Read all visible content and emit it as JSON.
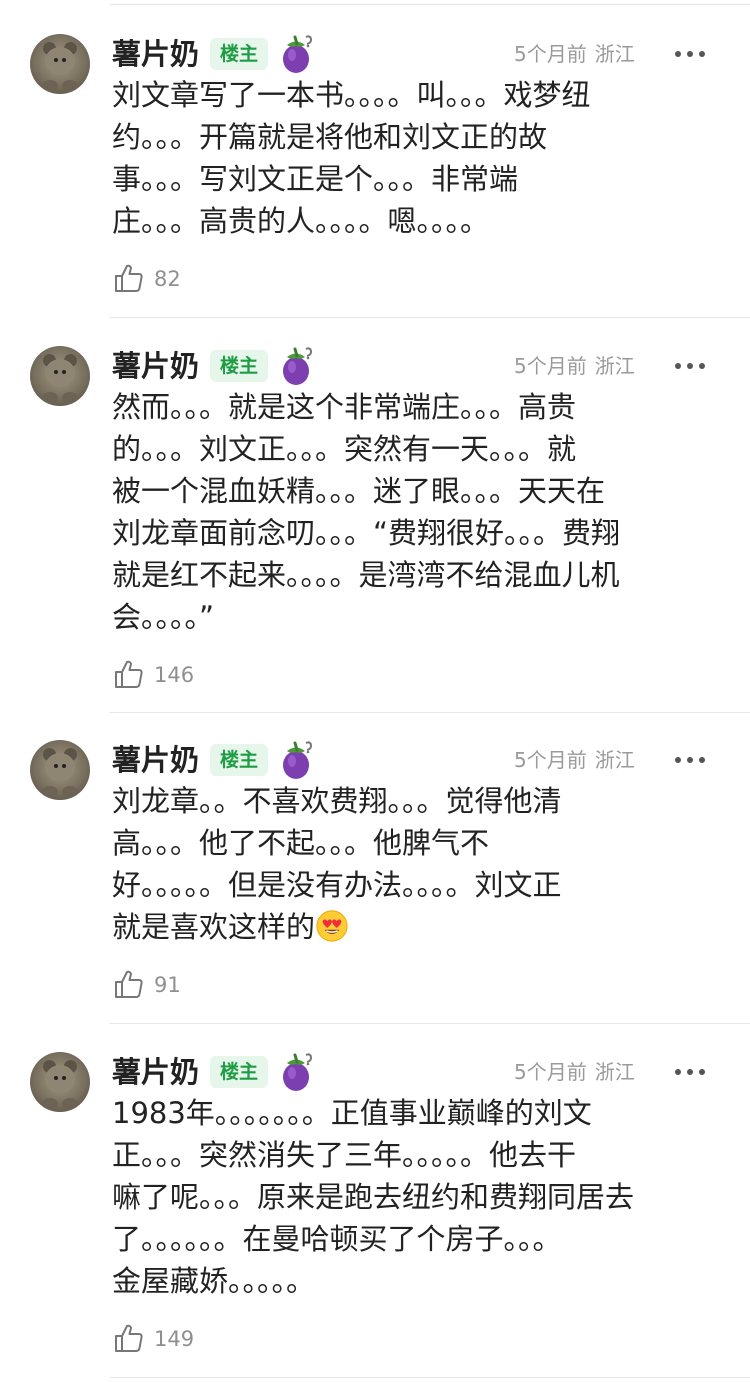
{
  "comments": [
    {
      "author": "薯片奶",
      "badge": "楼主",
      "time": "5个月前",
      "location": "浙江",
      "lines": [
        "刘文章写了一本书。。。。叫。。。戏梦纽",
        "约。。。开篇就是将他和刘文正的故",
        "事。。。写刘文正是个。。。非常端",
        "庄。。。高贵的人。。。。嗯。。。。"
      ],
      "likes": "82",
      "avatar_icon": "teddy-bear-avatar",
      "badge_icon": "eggplant-icon"
    },
    {
      "author": "薯片奶",
      "badge": "楼主",
      "time": "5个月前",
      "location": "浙江",
      "lines": [
        "然而。。。就是这个非常端庄。。。高贵",
        "的。。。刘文正。。。突然有一天。。。就",
        "被一个混血妖精。。。迷了眼。。。天天在",
        "刘龙章面前念叨。。。“费翔很好。。。费翔",
        "就是红不起来。。。。是湾湾不给混血儿机",
        "会。。。。”"
      ],
      "likes": "146",
      "avatar_icon": "teddy-bear-avatar",
      "badge_icon": "eggplant-icon"
    },
    {
      "author": "薯片奶",
      "badge": "楼主",
      "time": "5个月前",
      "location": "浙江",
      "lines": [
        "刘龙章。。不喜欢费翔。。。觉得他清",
        "高。。。他了不起。。。他脾气不",
        "好。。。。。但是没有办法。。。。刘文正",
        "就是喜欢这样的"
      ],
      "likes": "91",
      "avatar_icon": "teddy-bear-avatar",
      "badge_icon": "eggplant-icon",
      "trailing_emoji": "heart-eyes-emoji"
    },
    {
      "author": "薯片奶",
      "badge": "楼主",
      "time": "5个月前",
      "location": "浙江",
      "lines": [
        "1983年。。。。。。。正值事业巅峰的刘文",
        "正。。。突然消失了三年。。。。。他去干",
        "嘛了呢。。。原来是跑去纽约和费翔同居去",
        "了。。。。。。在曼哈顿买了个房子。。。",
        "金屋藏娇。。。。。"
      ],
      "likes": "149",
      "avatar_icon": "teddy-bear-avatar",
      "badge_icon": "eggplant-icon"
    }
  ],
  "colors": {
    "badge_text": "#1f9d45",
    "badge_bg": "#e7f6ea",
    "meta_text": "#9a9a9a",
    "divider": "#e6e6e6"
  }
}
